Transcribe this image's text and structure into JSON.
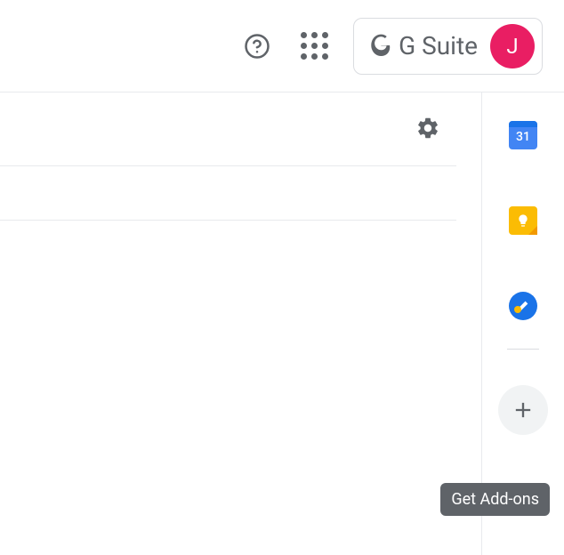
{
  "header": {
    "gsuite_label": "G Suite",
    "avatar_initial": "J"
  },
  "sidepanel": {
    "calendar_day": "31"
  },
  "tooltip": {
    "addons": "Get Add-ons"
  }
}
